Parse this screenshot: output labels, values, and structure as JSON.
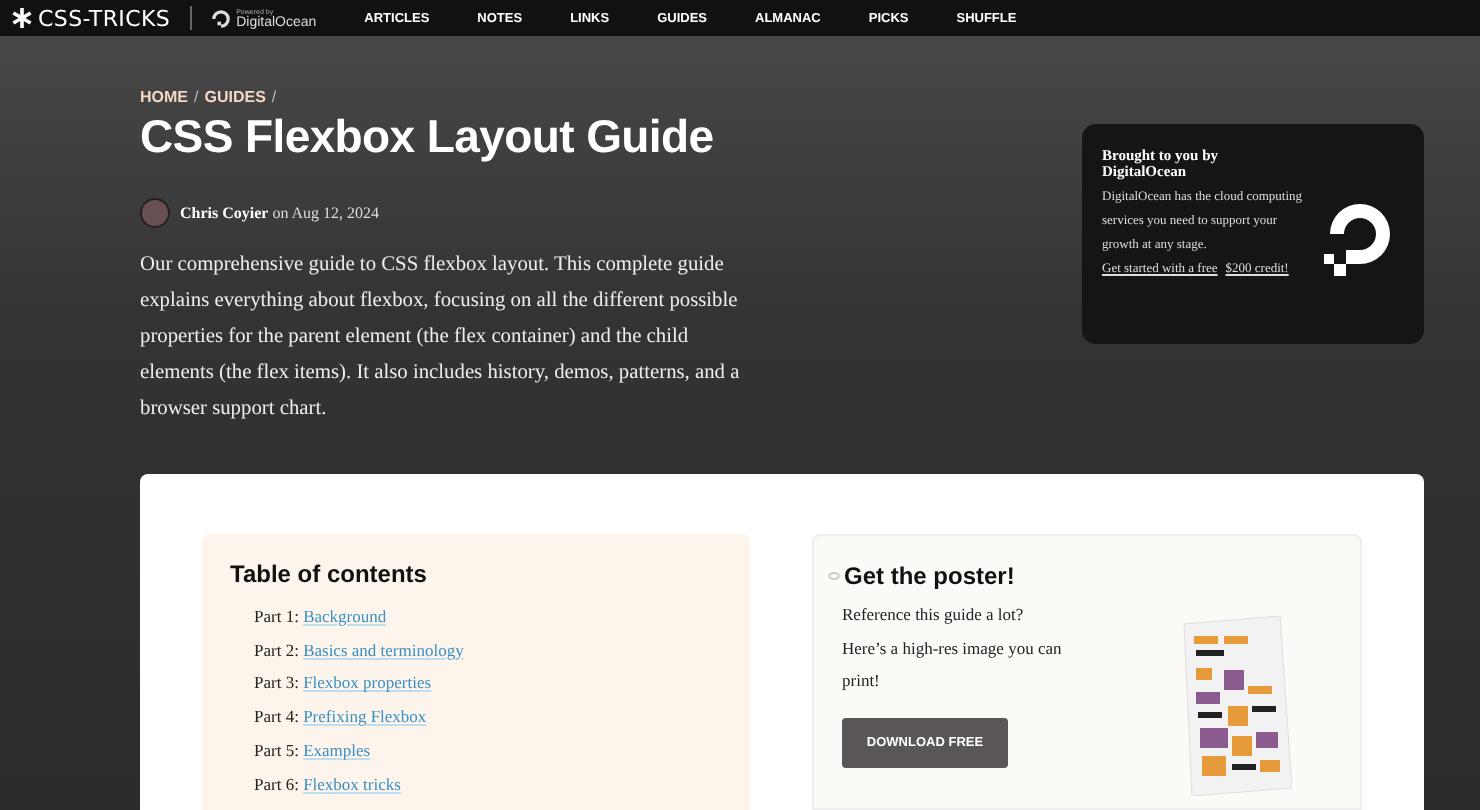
{
  "nav": {
    "logo": "CSS-TRICKS",
    "sponsor_small": "Powered by",
    "sponsor": "DigitalOcean",
    "links": [
      "ARTICLES",
      "NOTES",
      "LINKS",
      "GUIDES",
      "ALMANAC",
      "PICKS",
      "SHUFFLE"
    ]
  },
  "breadcrumb": {
    "items": [
      "HOME",
      "GUIDES"
    ],
    "separator": "/"
  },
  "title": "CSS Flexbox Layout Guide",
  "byline": {
    "author": "Chris Coyier",
    "date": "on Aug 12, 2024"
  },
  "intro": "Our comprehensive guide to CSS flexbox layout. This complete guide explains everything about flexbox, focusing on all the different possible properties for the parent element (the flex container) and the child elements (the flex items). It also includes history, demos, patterns, and a browser support chart.",
  "sponsor_card": {
    "title": "Brought to you by DigitalOcean",
    "text": "DigitalOcean has the cloud computing services you need to support your growth at any stage.",
    "link_lines": [
      "Get started with a free",
      "$200 credit!"
    ]
  },
  "toc": {
    "title": "Table of contents",
    "items": [
      {
        "part": "Part 1:",
        "link": "Background"
      },
      {
        "part": "Part 2:",
        "link": "Basics and terminology"
      },
      {
        "part": "Part 3:",
        "link": "Flexbox properties"
      },
      {
        "part": "Part 4:",
        "link": "Prefixing Flexbox"
      },
      {
        "part": "Part 5:",
        "link": "Examples"
      },
      {
        "part": "Part 6:",
        "link": "Flexbox tricks"
      }
    ]
  },
  "poster": {
    "title": "Get the poster!",
    "text": "Reference this guide a lot? Here’s a high-res image you can print!",
    "button": "DOWNLOAD FREE"
  }
}
